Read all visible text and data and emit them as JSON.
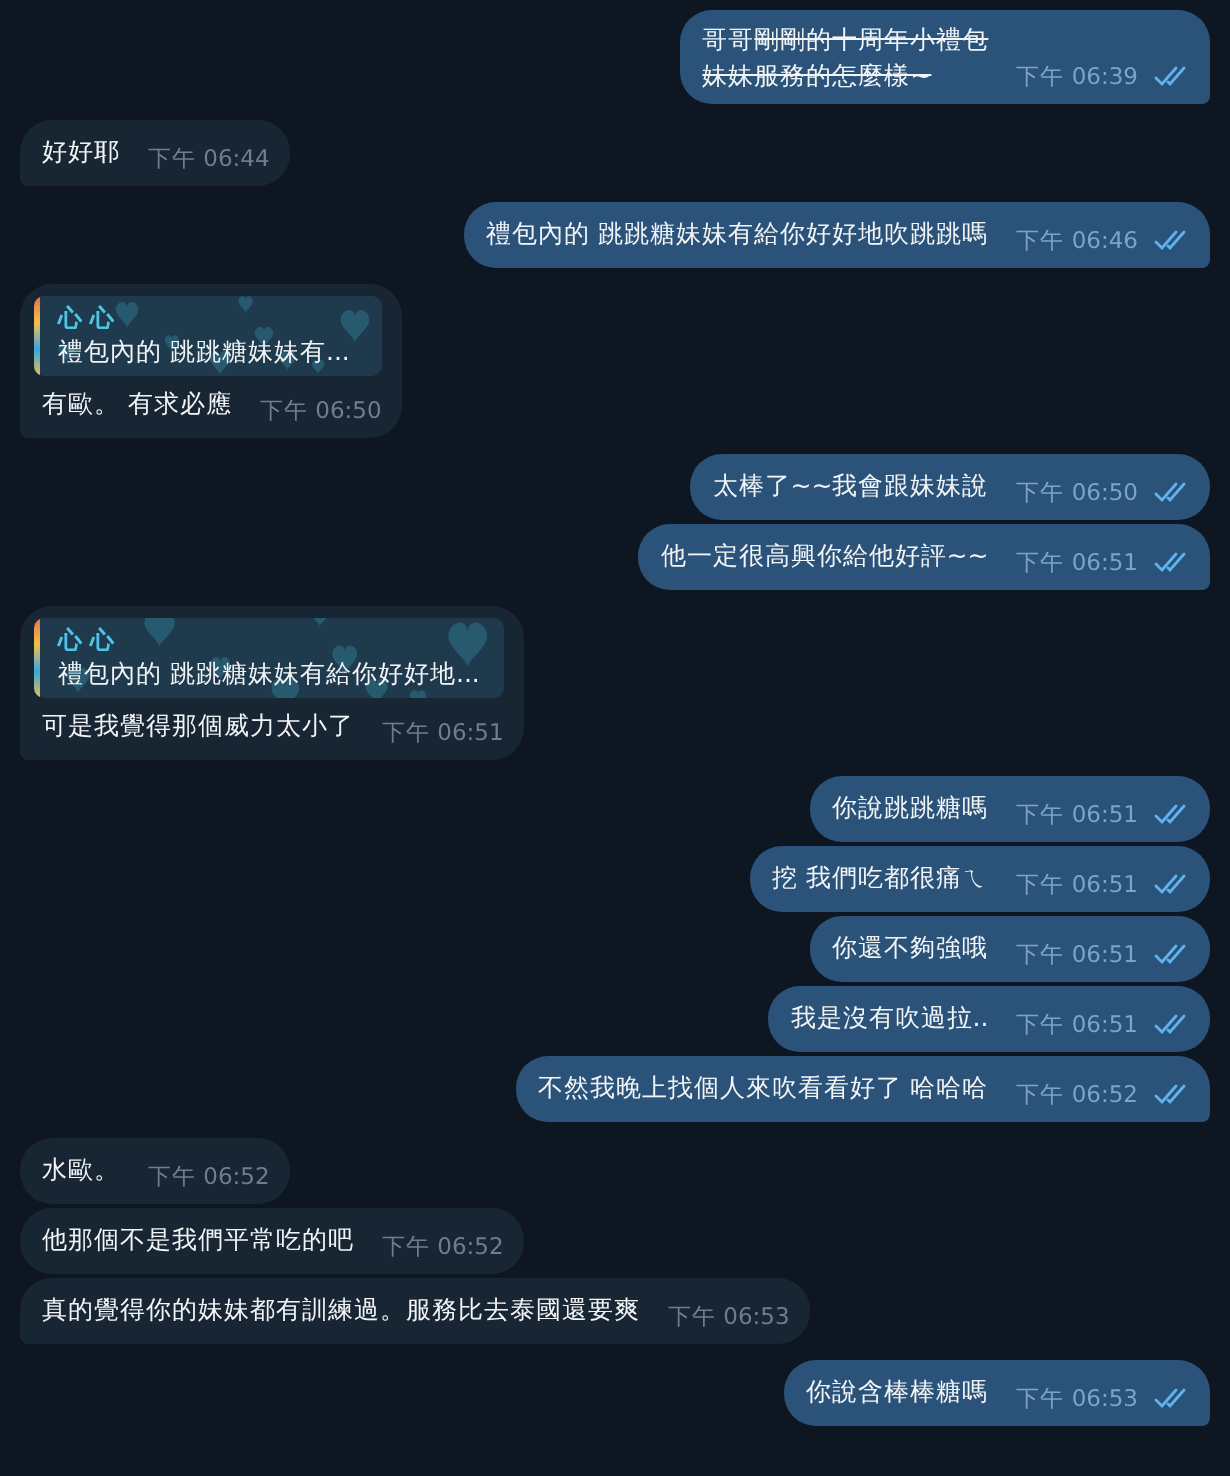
{
  "messages": [
    {
      "kind": "outgoing",
      "lines": [
        [
          {
            "text": "哥哥",
            "strike": false
          },
          {
            "text": "剛剛的十周年小禮包",
            "strike": true
          }
        ],
        [
          {
            "text": "妹妹服務的怎麼樣~",
            "strike": true
          }
        ]
      ],
      "time": "下午 06:39",
      "read": true
    },
    {
      "kind": "incoming",
      "text": "好好耶",
      "time": "下午 06:44"
    },
    {
      "kind": "outgoing",
      "text": "禮包內的 跳跳糖妹妹有給你好好地吹跳跳嗎",
      "time": "下午 06:46",
      "read": true
    },
    {
      "kind": "incoming",
      "reply": {
        "name": "心 心",
        "text": "禮包內的 跳跳糖妹妹有..."
      },
      "text": "有歐。 有求必應",
      "time": "下午 06:50"
    },
    {
      "kind": "outgoing",
      "text": "太棒了~~我會跟妹妹說",
      "time": "下午 06:50",
      "read": true
    },
    {
      "kind": "outgoing",
      "text": "他一定很高興你給他好評~~",
      "time": "下午 06:51",
      "read": true
    },
    {
      "kind": "incoming",
      "reply": {
        "name": "心 心",
        "text": "禮包內的 跳跳糖妹妹有給你好好地..."
      },
      "text": "可是我覺得那個威力太小了",
      "time": "下午 06:51"
    },
    {
      "kind": "outgoing",
      "text": "你說跳跳糖嗎",
      "time": "下午 06:51",
      "read": true
    },
    {
      "kind": "outgoing",
      "text": "挖 我們吃都很痛ㄟ",
      "time": "下午 06:51",
      "read": true
    },
    {
      "kind": "outgoing",
      "text": "你還不夠強哦",
      "time": "下午 06:51",
      "read": true
    },
    {
      "kind": "outgoing",
      "text": "我是沒有吹過拉..",
      "time": "下午 06:51",
      "read": true
    },
    {
      "kind": "outgoing",
      "text": "不然我晚上找個人來吹看看好了 哈哈哈",
      "time": "下午 06:52",
      "read": true
    },
    {
      "kind": "incoming",
      "text": "水歐。",
      "time": "下午 06:52"
    },
    {
      "kind": "incoming",
      "text": "他那個不是我們平常吃的吧",
      "time": "下午 06:52"
    },
    {
      "kind": "incoming",
      "text": "真的覺得你的妹妹都有訓練過。服務比去泰國還要爽",
      "time": "下午 06:53"
    },
    {
      "kind": "outgoing",
      "text": "你說含棒棒糖嗎",
      "time": "下午 06:53",
      "read": true
    }
  ]
}
